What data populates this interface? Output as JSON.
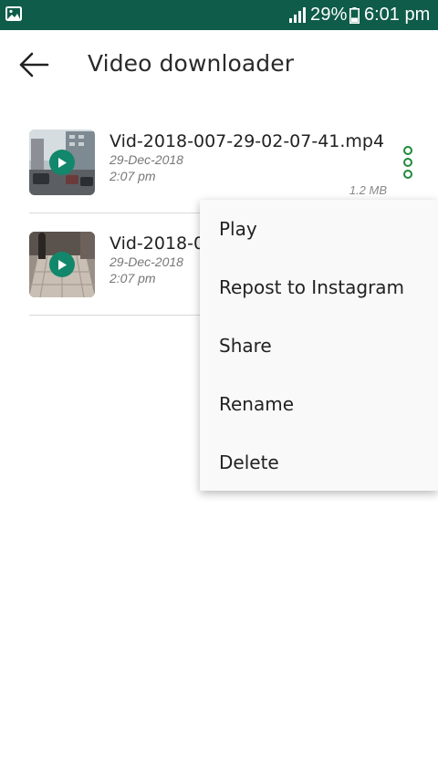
{
  "status_bar": {
    "battery_percent": "29%",
    "time": "6:01 pm",
    "icons": [
      "gallery-icon",
      "signal-icon",
      "battery-icon"
    ]
  },
  "header": {
    "title": "Video downloader",
    "back_icon": "arrow-left-icon"
  },
  "videos": [
    {
      "name": "Vid-2018-007-29-02-07-41.mp4",
      "date": "29-Dec-2018",
      "time": "2:07 pm",
      "size": "1.2 MB"
    },
    {
      "name": "Vid-2018-0",
      "date": "29-Dec-2018",
      "time": "2:07 pm",
      "size": ""
    }
  ],
  "context_menu": {
    "items": [
      "Play",
      "Repost to Instagram",
      "Share",
      "Rename",
      "Delete"
    ]
  },
  "colors": {
    "status_bar": "#0f5c4a",
    "accent": "#12876b",
    "more_icon": "#1f8a3a",
    "divider": "#d8d8d8"
  }
}
